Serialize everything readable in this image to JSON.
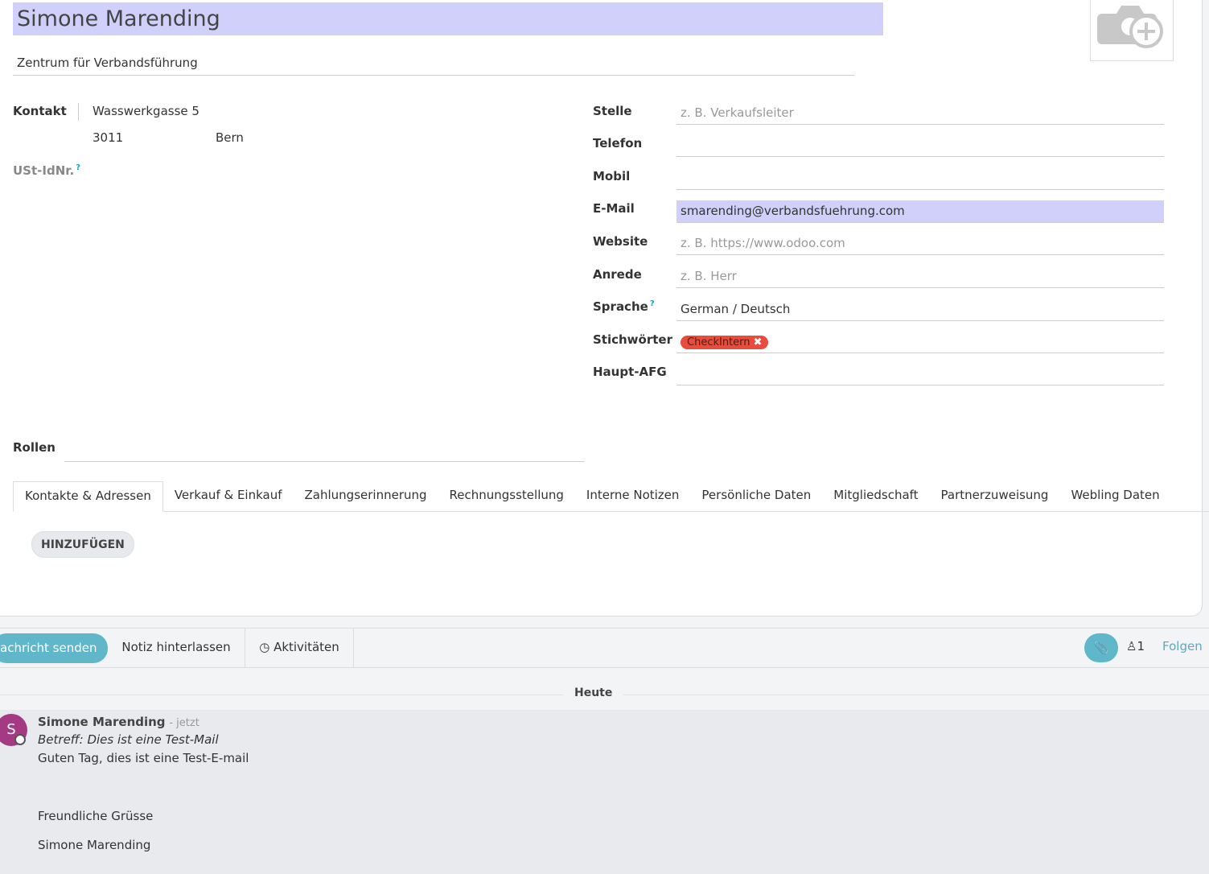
{
  "form": {
    "name": "Simone Marending",
    "company": "Zentrum für Verbandsführung",
    "photo_icon": "camera-plus-icon"
  },
  "left": {
    "kontakt_label": "Kontakt",
    "street": "Wasswerkgasse 5",
    "zip": "3011",
    "city": "Bern",
    "vat_label": "USt-IdNr.",
    "help_mark": "?",
    "roles_label": "Rollen"
  },
  "right": {
    "stelle_label": "Stelle",
    "stelle_placeholder": "z. B. Verkaufsleiter",
    "telefon_label": "Telefon",
    "mobil_label": "Mobil",
    "email_label": "E-Mail",
    "email_value": "smarending@verbandsfuehrung.com",
    "website_label": "Website",
    "website_placeholder": "z. B. https://www.odoo.com",
    "anrede_label": "Anrede",
    "anrede_placeholder": "z. B. Herr",
    "sprache_label": "Sprache",
    "sprache_value": "German / Deutsch",
    "tags_label": "Stichwörter",
    "tag_value": "CheckIntern",
    "haupt_label": "Haupt-AFG"
  },
  "tabs": [
    {
      "label": "Kontakte & Adressen"
    },
    {
      "label": "Verkauf & Einkauf"
    },
    {
      "label": "Zahlungserinnerung"
    },
    {
      "label": "Rechnungsstellung"
    },
    {
      "label": "Interne Notizen"
    },
    {
      "label": "Persönliche Daten"
    },
    {
      "label": "Mitgliedschaft"
    },
    {
      "label": "Partnerzuweisung"
    },
    {
      "label": "Webling Daten"
    }
  ],
  "add_button": "HINZUFÜGEN",
  "chatter": {
    "send_label": "achricht senden",
    "note_label": "Notiz hinterlassen",
    "activities_label": "Aktivitäten",
    "followers_count": "1",
    "follow_label": "Folgen",
    "today_label": "Heute"
  },
  "message": {
    "avatar_letter": "S",
    "author": "Simone Marending",
    "time": "- jetzt",
    "subject": "Betreff: Dies ist eine Test-Mail",
    "body_line1": "Guten Tag, dies ist eine Test-E-mail",
    "body_line2": "Freundliche Grüsse",
    "body_line3": "Simone Marending"
  }
}
